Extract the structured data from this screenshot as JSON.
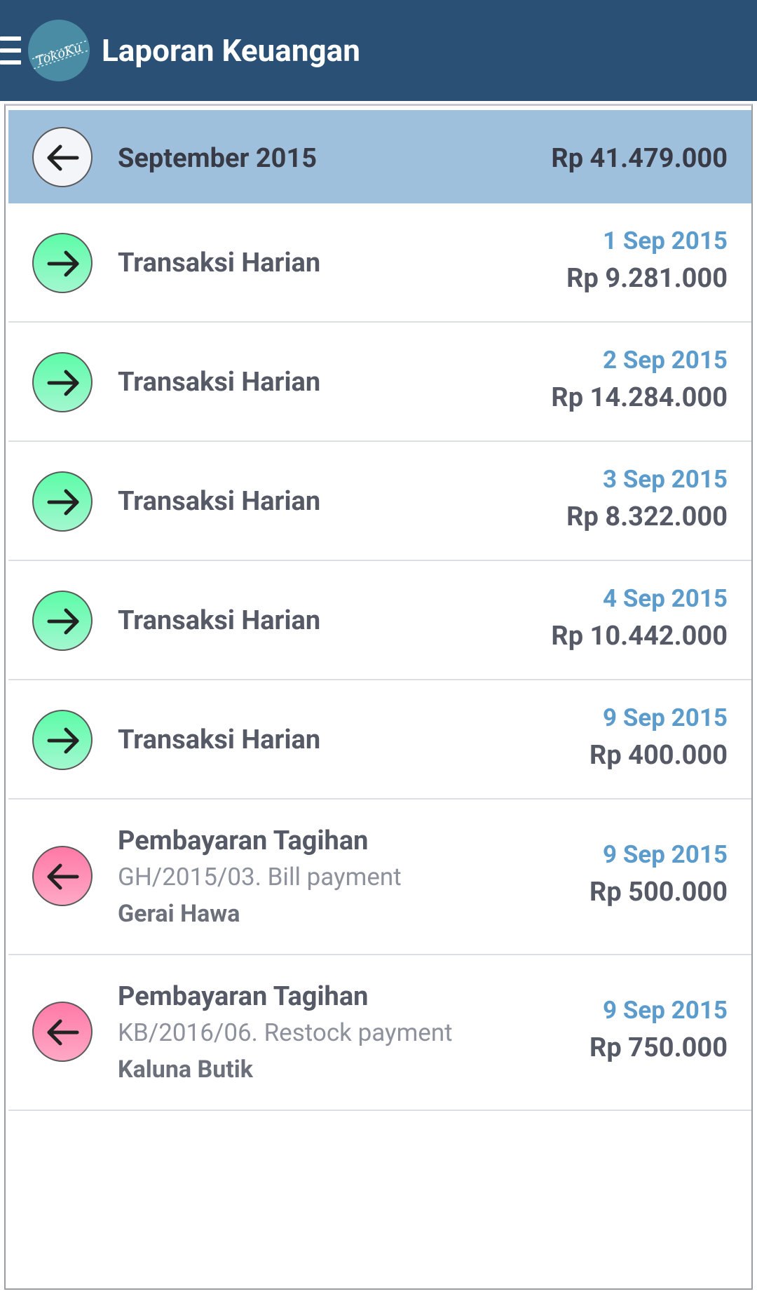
{
  "appbar": {
    "title": "Laporan Keuangan",
    "logo_text": "TokoKu",
    "menu_icon": "hamburger-menu-icon",
    "colors": {
      "background": "#2a5076",
      "logo": "#4a8ca3"
    }
  },
  "summary": {
    "period": "September 2015",
    "total": "Rp 41.479.000",
    "back_icon": "arrow-left-icon",
    "background": "#9fc0dd"
  },
  "transactions": [
    {
      "type": "in",
      "icon": "arrow-right-icon",
      "title": "Transaksi Harian",
      "date": "1 Sep 2015",
      "amount": "Rp 9.281.000"
    },
    {
      "type": "in",
      "icon": "arrow-right-icon",
      "title": "Transaksi Harian",
      "date": "2 Sep 2015",
      "amount": "Rp 14.284.000"
    },
    {
      "type": "in",
      "icon": "arrow-right-icon",
      "title": "Transaksi Harian",
      "date": "3 Sep 2015",
      "amount": "Rp 8.322.000"
    },
    {
      "type": "in",
      "icon": "arrow-right-icon",
      "title": "Transaksi Harian",
      "date": "4 Sep 2015",
      "amount": "Rp 10.442.000"
    },
    {
      "type": "in",
      "icon": "arrow-right-icon",
      "title": "Transaksi Harian",
      "date": "9 Sep 2015",
      "amount": "Rp 400.000"
    },
    {
      "type": "out",
      "icon": "arrow-left-icon",
      "title": "Pembayaran Tagihan",
      "description": "GH/2015/03. Bill payment",
      "party": "Gerai Hawa",
      "date": "9 Sep 2015",
      "amount": "Rp 500.000"
    },
    {
      "type": "out",
      "icon": "arrow-left-icon",
      "title": "Pembayaran Tagihan",
      "description": "KB/2016/06. Restock payment",
      "party": "Kaluna Butik",
      "date": "9 Sep 2015",
      "amount": "Rp 750.000"
    }
  ],
  "colors": {
    "incoming": "#5dfca8",
    "outgoing": "#ff7aa6",
    "date_text": "#5c9ccc",
    "amount_text": "#555a66"
  }
}
